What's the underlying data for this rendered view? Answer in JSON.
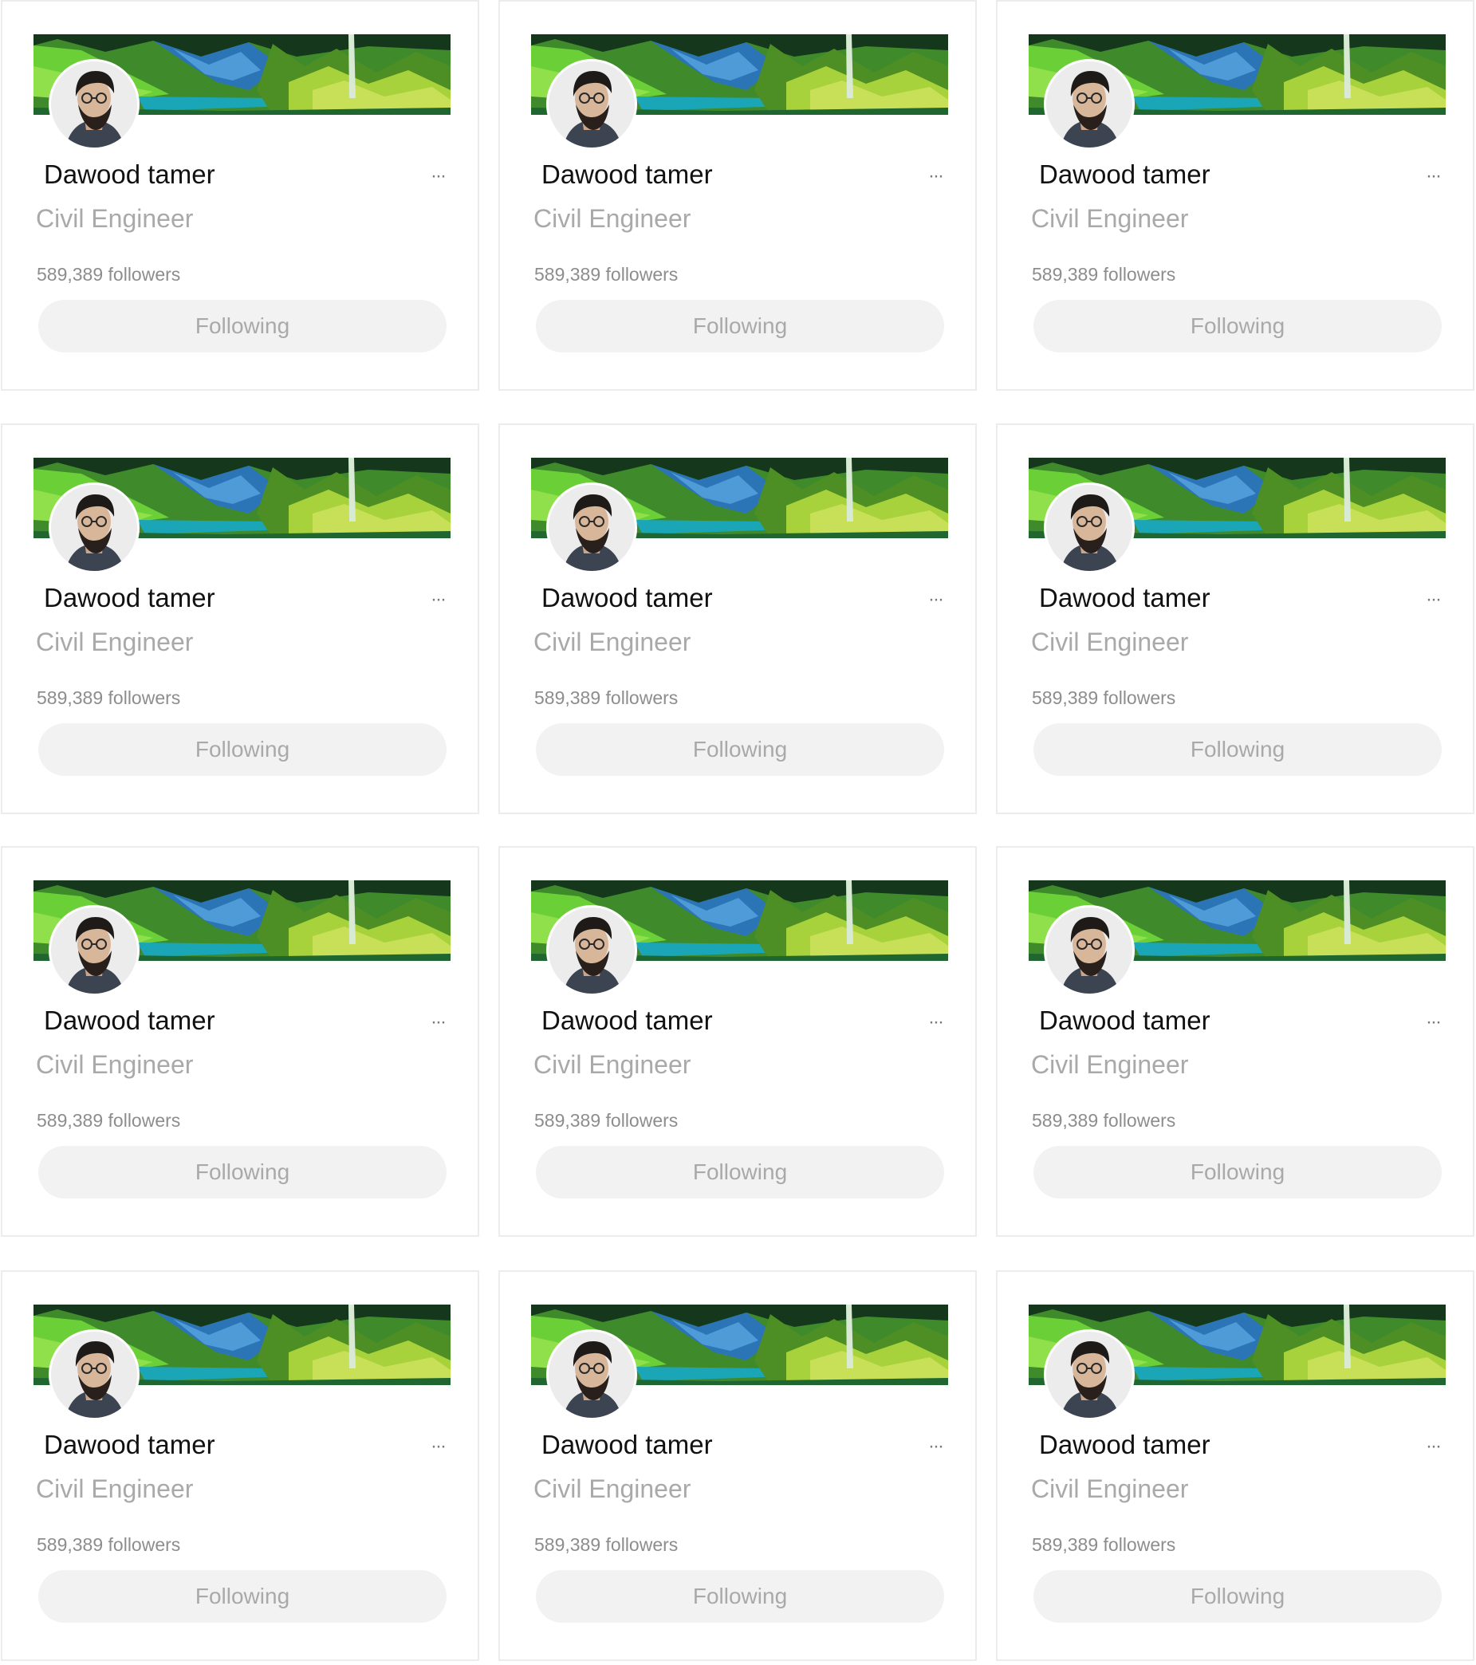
{
  "cards": [
    {
      "name": "Dawood tamer",
      "title": "Civil Engineer",
      "followers": "589,389 followers",
      "button_label": "Following",
      "more_label": "···",
      "banner_icon": "landscape-banner",
      "avatar_icon": "profile-photo"
    },
    {
      "name": "Dawood tamer",
      "title": "Civil Engineer",
      "followers": "589,389 followers",
      "button_label": "Following",
      "more_label": "···",
      "banner_icon": "landscape-banner",
      "avatar_icon": "profile-photo"
    },
    {
      "name": "Dawood tamer",
      "title": "Civil Engineer",
      "followers": "589,389 followers",
      "button_label": "Following",
      "more_label": "···",
      "banner_icon": "landscape-banner",
      "avatar_icon": "profile-photo"
    },
    {
      "name": "Dawood tamer",
      "title": "Civil Engineer",
      "followers": "589,389 followers",
      "button_label": "Following",
      "more_label": "···",
      "banner_icon": "landscape-banner",
      "avatar_icon": "profile-photo"
    },
    {
      "name": "Dawood tamer",
      "title": "Civil Engineer",
      "followers": "589,389 followers",
      "button_label": "Following",
      "more_label": "···",
      "banner_icon": "landscape-banner",
      "avatar_icon": "profile-photo"
    },
    {
      "name": "Dawood tamer",
      "title": "Civil Engineer",
      "followers": "589,389 followers",
      "button_label": "Following",
      "more_label": "···",
      "banner_icon": "landscape-banner",
      "avatar_icon": "profile-photo"
    },
    {
      "name": "Dawood tamer",
      "title": "Civil Engineer",
      "followers": "589,389 followers",
      "button_label": "Following",
      "more_label": "···",
      "banner_icon": "landscape-banner",
      "avatar_icon": "profile-photo"
    },
    {
      "name": "Dawood tamer",
      "title": "Civil Engineer",
      "followers": "589,389 followers",
      "button_label": "Following",
      "more_label": "···",
      "banner_icon": "landscape-banner",
      "avatar_icon": "profile-photo"
    },
    {
      "name": "Dawood tamer",
      "title": "Civil Engineer",
      "followers": "589,389 followers",
      "button_label": "Following",
      "more_label": "···",
      "banner_icon": "landscape-banner",
      "avatar_icon": "profile-photo"
    },
    {
      "name": "Dawood tamer",
      "title": "Civil Engineer",
      "followers": "589,389 followers",
      "button_label": "Following",
      "more_label": "···",
      "banner_icon": "landscape-banner",
      "avatar_icon": "profile-photo"
    },
    {
      "name": "Dawood tamer",
      "title": "Civil Engineer",
      "followers": "589,389 followers",
      "button_label": "Following",
      "more_label": "···",
      "banner_icon": "landscape-banner",
      "avatar_icon": "profile-photo"
    },
    {
      "name": "Dawood tamer",
      "title": "Civil Engineer",
      "followers": "589,389 followers",
      "button_label": "Following",
      "more_label": "···",
      "banner_icon": "landscape-banner",
      "avatar_icon": "profile-photo"
    }
  ],
  "colors": {
    "card_border": "#ececec",
    "name_text": "#111111",
    "title_text": "#a9a9a9",
    "followers_text": "#8d8d8d",
    "button_bg": "#f2f2f2",
    "button_text": "#a9a9a9"
  }
}
